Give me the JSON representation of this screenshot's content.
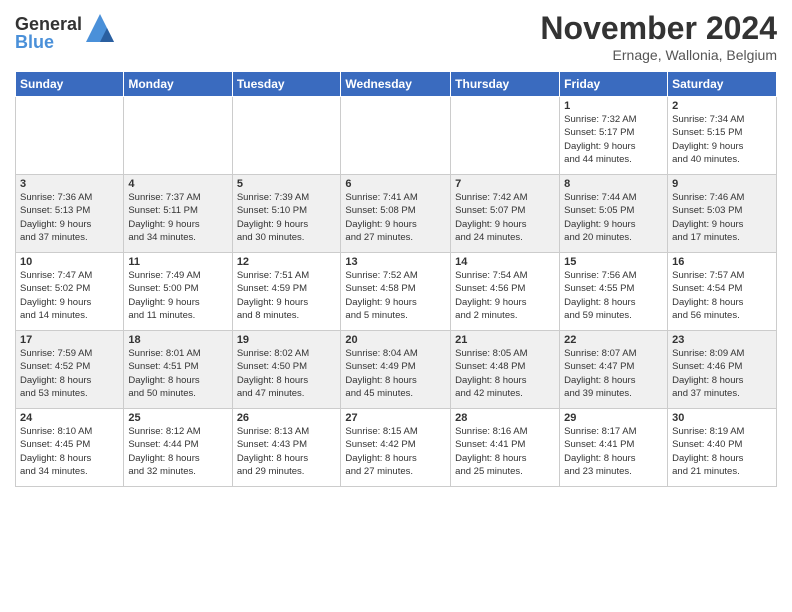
{
  "header": {
    "logo_general": "General",
    "logo_blue": "Blue",
    "month_title": "November 2024",
    "location": "Ernage, Wallonia, Belgium"
  },
  "days_of_week": [
    "Sunday",
    "Monday",
    "Tuesday",
    "Wednesday",
    "Thursday",
    "Friday",
    "Saturday"
  ],
  "weeks": [
    [
      {
        "day": "",
        "info": ""
      },
      {
        "day": "",
        "info": ""
      },
      {
        "day": "",
        "info": ""
      },
      {
        "day": "",
        "info": ""
      },
      {
        "day": "",
        "info": ""
      },
      {
        "day": "1",
        "info": "Sunrise: 7:32 AM\nSunset: 5:17 PM\nDaylight: 9 hours\nand 44 minutes."
      },
      {
        "day": "2",
        "info": "Sunrise: 7:34 AM\nSunset: 5:15 PM\nDaylight: 9 hours\nand 40 minutes."
      }
    ],
    [
      {
        "day": "3",
        "info": "Sunrise: 7:36 AM\nSunset: 5:13 PM\nDaylight: 9 hours\nand 37 minutes."
      },
      {
        "day": "4",
        "info": "Sunrise: 7:37 AM\nSunset: 5:11 PM\nDaylight: 9 hours\nand 34 minutes."
      },
      {
        "day": "5",
        "info": "Sunrise: 7:39 AM\nSunset: 5:10 PM\nDaylight: 9 hours\nand 30 minutes."
      },
      {
        "day": "6",
        "info": "Sunrise: 7:41 AM\nSunset: 5:08 PM\nDaylight: 9 hours\nand 27 minutes."
      },
      {
        "day": "7",
        "info": "Sunrise: 7:42 AM\nSunset: 5:07 PM\nDaylight: 9 hours\nand 24 minutes."
      },
      {
        "day": "8",
        "info": "Sunrise: 7:44 AM\nSunset: 5:05 PM\nDaylight: 9 hours\nand 20 minutes."
      },
      {
        "day": "9",
        "info": "Sunrise: 7:46 AM\nSunset: 5:03 PM\nDaylight: 9 hours\nand 17 minutes."
      }
    ],
    [
      {
        "day": "10",
        "info": "Sunrise: 7:47 AM\nSunset: 5:02 PM\nDaylight: 9 hours\nand 14 minutes."
      },
      {
        "day": "11",
        "info": "Sunrise: 7:49 AM\nSunset: 5:00 PM\nDaylight: 9 hours\nand 11 minutes."
      },
      {
        "day": "12",
        "info": "Sunrise: 7:51 AM\nSunset: 4:59 PM\nDaylight: 9 hours\nand 8 minutes."
      },
      {
        "day": "13",
        "info": "Sunrise: 7:52 AM\nSunset: 4:58 PM\nDaylight: 9 hours\nand 5 minutes."
      },
      {
        "day": "14",
        "info": "Sunrise: 7:54 AM\nSunset: 4:56 PM\nDaylight: 9 hours\nand 2 minutes."
      },
      {
        "day": "15",
        "info": "Sunrise: 7:56 AM\nSunset: 4:55 PM\nDaylight: 8 hours\nand 59 minutes."
      },
      {
        "day": "16",
        "info": "Sunrise: 7:57 AM\nSunset: 4:54 PM\nDaylight: 8 hours\nand 56 minutes."
      }
    ],
    [
      {
        "day": "17",
        "info": "Sunrise: 7:59 AM\nSunset: 4:52 PM\nDaylight: 8 hours\nand 53 minutes."
      },
      {
        "day": "18",
        "info": "Sunrise: 8:01 AM\nSunset: 4:51 PM\nDaylight: 8 hours\nand 50 minutes."
      },
      {
        "day": "19",
        "info": "Sunrise: 8:02 AM\nSunset: 4:50 PM\nDaylight: 8 hours\nand 47 minutes."
      },
      {
        "day": "20",
        "info": "Sunrise: 8:04 AM\nSunset: 4:49 PM\nDaylight: 8 hours\nand 45 minutes."
      },
      {
        "day": "21",
        "info": "Sunrise: 8:05 AM\nSunset: 4:48 PM\nDaylight: 8 hours\nand 42 minutes."
      },
      {
        "day": "22",
        "info": "Sunrise: 8:07 AM\nSunset: 4:47 PM\nDaylight: 8 hours\nand 39 minutes."
      },
      {
        "day": "23",
        "info": "Sunrise: 8:09 AM\nSunset: 4:46 PM\nDaylight: 8 hours\nand 37 minutes."
      }
    ],
    [
      {
        "day": "24",
        "info": "Sunrise: 8:10 AM\nSunset: 4:45 PM\nDaylight: 8 hours\nand 34 minutes."
      },
      {
        "day": "25",
        "info": "Sunrise: 8:12 AM\nSunset: 4:44 PM\nDaylight: 8 hours\nand 32 minutes."
      },
      {
        "day": "26",
        "info": "Sunrise: 8:13 AM\nSunset: 4:43 PM\nDaylight: 8 hours\nand 29 minutes."
      },
      {
        "day": "27",
        "info": "Sunrise: 8:15 AM\nSunset: 4:42 PM\nDaylight: 8 hours\nand 27 minutes."
      },
      {
        "day": "28",
        "info": "Sunrise: 8:16 AM\nSunset: 4:41 PM\nDaylight: 8 hours\nand 25 minutes."
      },
      {
        "day": "29",
        "info": "Sunrise: 8:17 AM\nSunset: 4:41 PM\nDaylight: 8 hours\nand 23 minutes."
      },
      {
        "day": "30",
        "info": "Sunrise: 8:19 AM\nSunset: 4:40 PM\nDaylight: 8 hours\nand 21 minutes."
      }
    ]
  ]
}
